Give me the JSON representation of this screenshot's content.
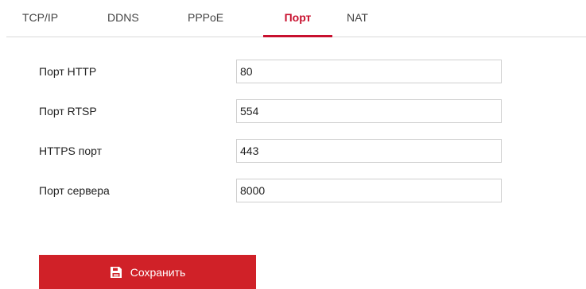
{
  "tabs": [
    {
      "label": "TCP/IP",
      "active": false
    },
    {
      "label": "DDNS",
      "active": false
    },
    {
      "label": "PPPoE",
      "active": false
    },
    {
      "label": "Порт",
      "active": true
    },
    {
      "label": "NAT",
      "active": false
    }
  ],
  "fields": [
    {
      "label": "Порт HTTP",
      "value": "80"
    },
    {
      "label": "Порт RTSP",
      "value": "554"
    },
    {
      "label": "HTTPS порт",
      "value": "443"
    },
    {
      "label": "Порт сервера",
      "value": "8000"
    }
  ],
  "save_button": {
    "label": "Сохранить",
    "icon": "floppy-disk-icon"
  },
  "colors": {
    "accent": "#d02128",
    "active_tab": "#c8102e",
    "divider": "#d9d9d9",
    "input_border": "#cfcfcf"
  }
}
